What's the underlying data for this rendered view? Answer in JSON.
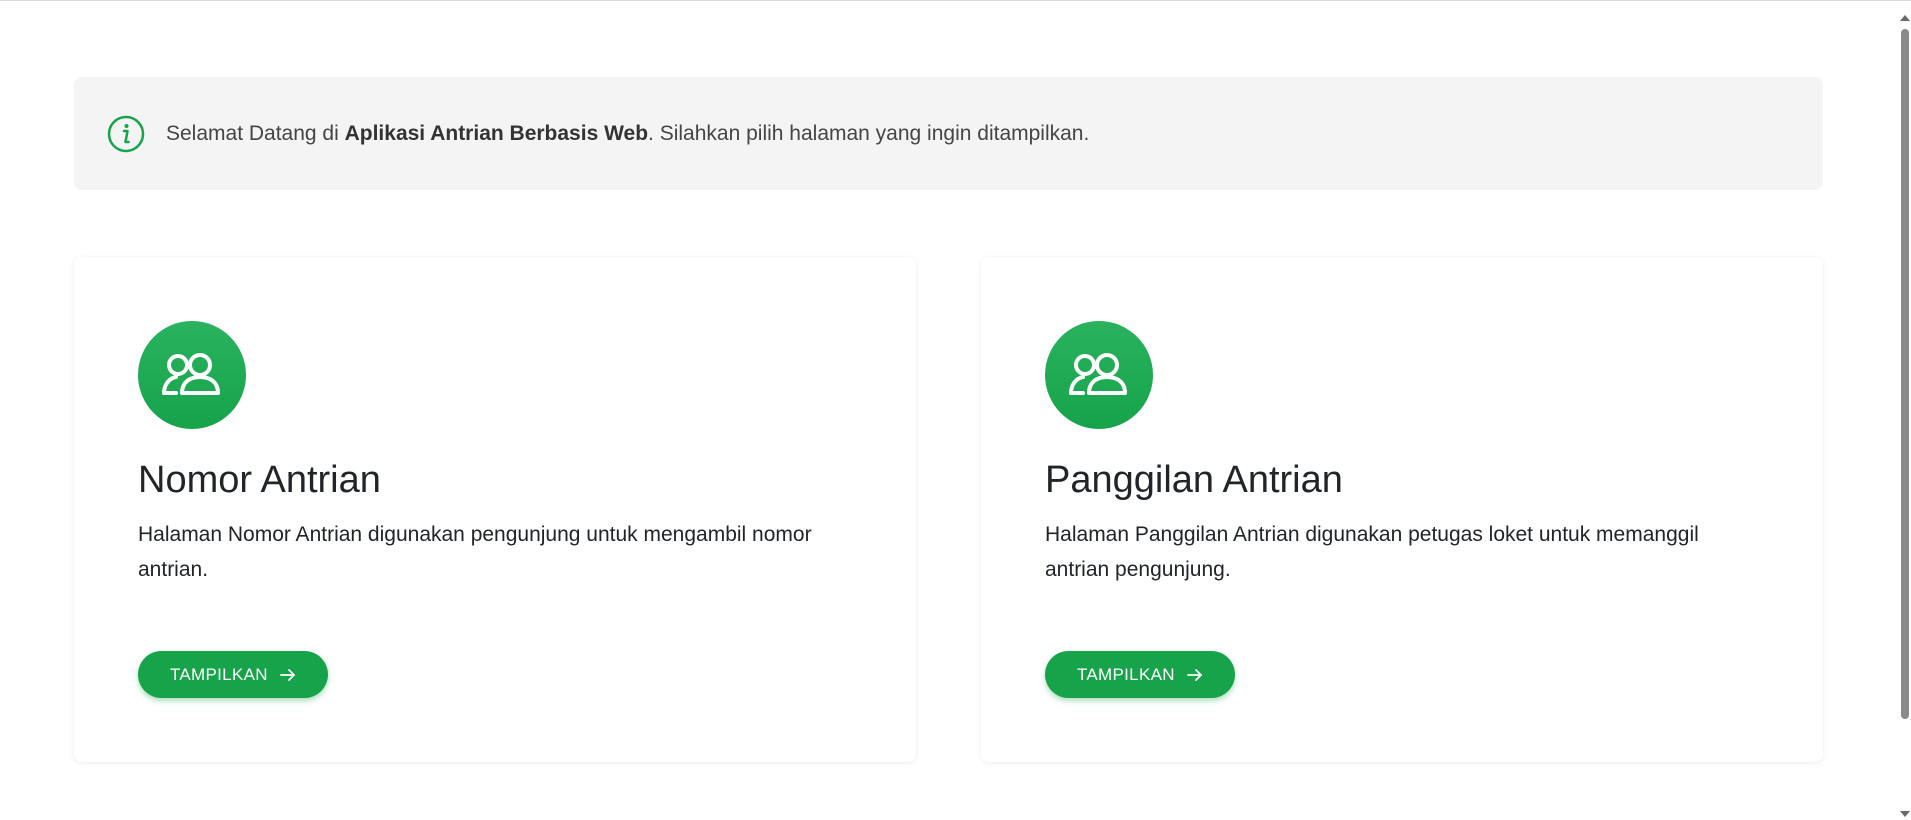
{
  "alert": {
    "icon": "info-circle-icon",
    "text_prefix": "Selamat Datang di ",
    "text_bold": "Aplikasi Antrian Berbasis Web",
    "text_suffix": ". Silahkan pilih halaman yang ingin ditampilkan."
  },
  "cards": [
    {
      "icon": "people-icon",
      "title": "Nomor Antrian",
      "description": "Halaman Nomor Antrian digunakan pengunjung untuk mengambil nomor antrian.",
      "button_label": "TAMPILKAN"
    },
    {
      "icon": "people-icon",
      "title": "Panggilan Antrian",
      "description": "Halaman Panggilan Antrian digunakan petugas loket untuk memanggil antrian pengunjung.",
      "button_label": "TAMPILKAN"
    }
  ],
  "colors": {
    "accent": "#16a34a",
    "alert_bg": "#f4f4f4"
  }
}
